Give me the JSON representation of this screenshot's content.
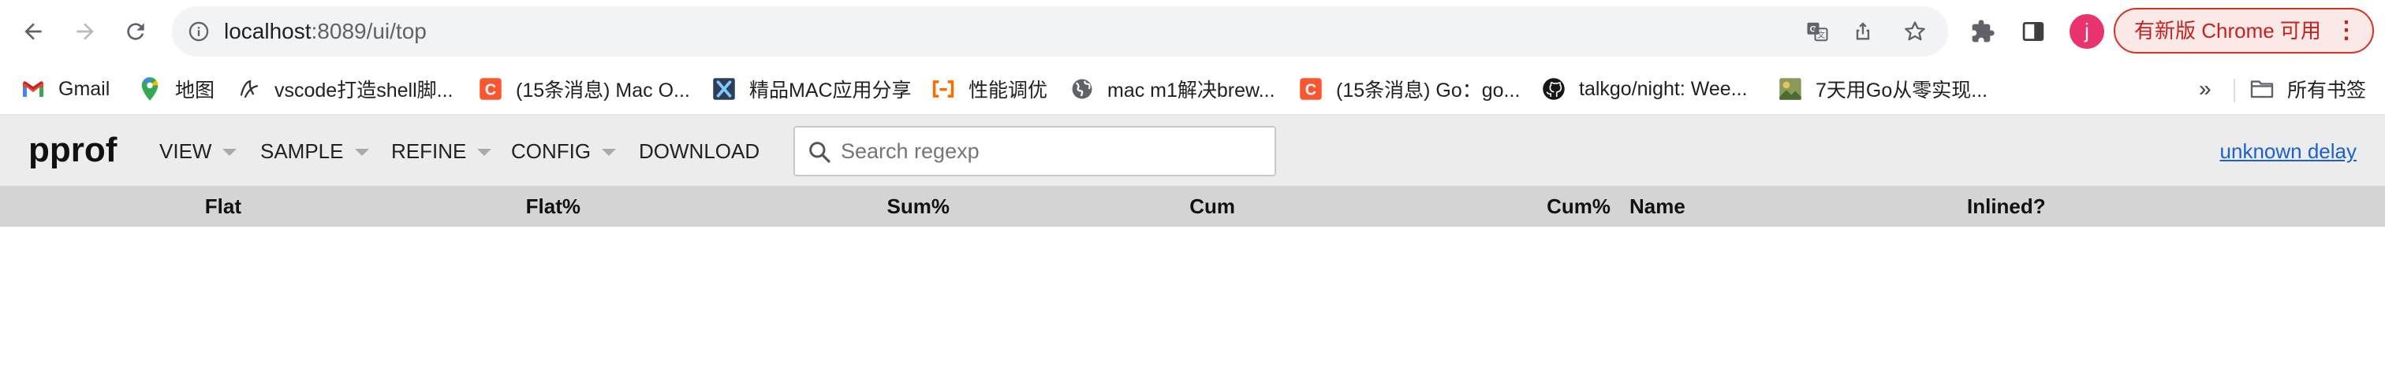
{
  "browser": {
    "url_host": "localhost",
    "url_path": ":8089/ui/top",
    "avatar_letter": "j",
    "update_label": "有新版 Chrome 可用",
    "menu_glyph": "⋮"
  },
  "bookmarks": {
    "items": [
      {
        "label": "Gmail",
        "icon": "gmail-icon"
      },
      {
        "label": "地图",
        "icon": "maps-icon"
      },
      {
        "label": "vscode打造shell脚...",
        "icon": "vscode-icon"
      },
      {
        "label": "(15条消息) Mac O...",
        "icon": "csdn-icon"
      },
      {
        "label": "精品MAC应用分享",
        "icon": "x-app-icon"
      },
      {
        "label": "性能调优",
        "icon": "bracket-icon"
      },
      {
        "label": "mac m1解决brew...",
        "icon": "globe-icon"
      },
      {
        "label": "(15条消息) Go：go...",
        "icon": "csdn-icon"
      },
      {
        "label": "talkgo/night: Wee...",
        "icon": "github-icon"
      },
      {
        "label": "7天用Go从零实现...",
        "icon": "image-icon"
      }
    ],
    "more": "»",
    "all_bookmarks": "所有书签"
  },
  "pprof": {
    "logo": "pprof",
    "menu": {
      "view": "VIEW",
      "sample": "SAMPLE",
      "refine": "REFINE",
      "config": "CONFIG",
      "download": "DOWNLOAD"
    },
    "search_placeholder": "Search regexp",
    "delay_link": "unknown delay"
  },
  "table": {
    "columns": [
      "Flat",
      "Flat%",
      "Sum%",
      "Cum",
      "Cum%",
      "Name",
      "Inlined?"
    ],
    "rows": []
  },
  "colors": {
    "header_bg": "#ececec",
    "table_header_bg": "#d4d4d4",
    "link": "#1a5fd4",
    "update_red": "#c5221f"
  }
}
